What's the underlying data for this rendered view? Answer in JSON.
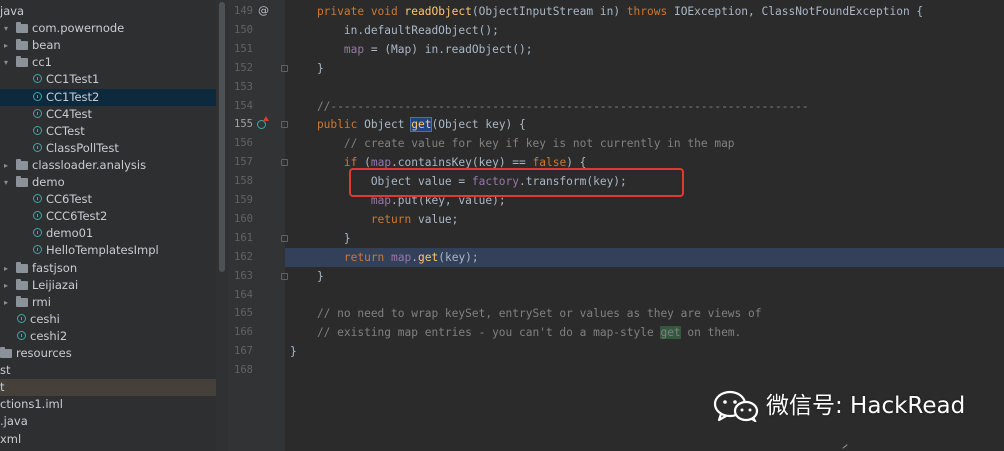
{
  "project_tree": {
    "items": [
      {
        "label": "java",
        "type": "text",
        "indent": 0
      },
      {
        "label": "com.powernode",
        "type": "package",
        "indent": 1,
        "arrow": "open"
      },
      {
        "label": "bean",
        "type": "package",
        "indent": 2,
        "arrow": "closed"
      },
      {
        "label": "cc1",
        "type": "package",
        "indent": 2,
        "arrow": "open"
      },
      {
        "label": "CC1Test1",
        "type": "class",
        "indent": 3
      },
      {
        "label": "CC1Test2",
        "type": "class",
        "indent": 3,
        "state": "selected"
      },
      {
        "label": "CC4Test",
        "type": "class",
        "indent": 3
      },
      {
        "label": "CCTest",
        "type": "class",
        "indent": 3
      },
      {
        "label": "ClassPollTest",
        "type": "class",
        "indent": 3
      },
      {
        "label": "classloader.analysis",
        "type": "package",
        "indent": 2,
        "arrow": "closed"
      },
      {
        "label": "demo",
        "type": "package",
        "indent": 2,
        "arrow": "open"
      },
      {
        "label": "CC6Test",
        "type": "class",
        "indent": 3
      },
      {
        "label": "CCC6Test2",
        "type": "class",
        "indent": 3
      },
      {
        "label": "demo01",
        "type": "class",
        "indent": 3
      },
      {
        "label": "HelloTemplatesImpl",
        "type": "class",
        "indent": 3
      },
      {
        "label": "fastjson",
        "type": "package",
        "indent": 2,
        "arrow": "closed"
      },
      {
        "label": "Leijiazai",
        "type": "package",
        "indent": 2,
        "arrow": "closed"
      },
      {
        "label": "rmi",
        "type": "package",
        "indent": 2,
        "arrow": "closed"
      },
      {
        "label": "ceshi",
        "type": "class",
        "indent": 2
      },
      {
        "label": "ceshi2",
        "type": "class",
        "indent": 2
      },
      {
        "label": "resources",
        "type": "package",
        "indent": 0
      },
      {
        "label": "st",
        "type": "text",
        "indent": 0
      },
      {
        "label": "t",
        "type": "text",
        "indent": 0,
        "state": "highlighted"
      },
      {
        "label": "ctions1.iml",
        "type": "text",
        "indent": 0
      },
      {
        "label": ".java",
        "type": "text",
        "indent": 0
      },
      {
        "label": "xml",
        "type": "text",
        "indent": 0
      }
    ]
  },
  "editor": {
    "current_line": "155",
    "lines": [
      {
        "num": "149",
        "segments": [
          [
            "kw",
            "    private void "
          ],
          [
            "fn",
            "readObject"
          ],
          [
            "",
            "(ObjectInputStream in) "
          ],
          [
            "kw",
            "throws "
          ],
          [
            "",
            "IOException, ClassNotFoundException {"
          ]
        ]
      },
      {
        "num": "150",
        "segments": [
          [
            "",
            "        in.defaultReadObject();"
          ]
        ]
      },
      {
        "num": "151",
        "segments": [
          [
            "",
            "        "
          ],
          [
            "fld",
            "map"
          ],
          [
            "",
            " = (Map) in.readObject();"
          ]
        ]
      },
      {
        "num": "152",
        "segments": [
          [
            "",
            "    }"
          ]
        ]
      },
      {
        "num": "153",
        "segments": []
      },
      {
        "num": "154",
        "segments": [
          [
            "cm",
            "    //-----------------------------------------------------------------------"
          ]
        ]
      },
      {
        "num": "155",
        "segments": [
          [
            "kw",
            "    public "
          ],
          [
            "",
            "Object "
          ],
          [
            "hlbox",
            "get"
          ],
          [
            "",
            "(Object key) {"
          ]
        ]
      },
      {
        "num": "156",
        "segments": [
          [
            "cm",
            "        // create value for key if key is not currently in the map"
          ]
        ]
      },
      {
        "num": "157",
        "segments": [
          [
            "kw",
            "        if "
          ],
          [
            "",
            "("
          ],
          [
            "fld",
            "map"
          ],
          [
            "",
            ".containsKey(key) == "
          ],
          [
            "kw",
            "false"
          ],
          [
            "",
            ") {"
          ]
        ]
      },
      {
        "num": "158",
        "segments": [
          [
            "",
            "            Object value = "
          ],
          [
            "fld",
            "factory"
          ],
          [
            "",
            ".transform(key);"
          ]
        ]
      },
      {
        "num": "159",
        "segments": [
          [
            "",
            "            "
          ],
          [
            "fld",
            "map"
          ],
          [
            "",
            ".put(key, value);"
          ]
        ]
      },
      {
        "num": "160",
        "segments": [
          [
            "kw",
            "            return "
          ],
          [
            "",
            "value;"
          ]
        ]
      },
      {
        "num": "161",
        "segments": [
          [
            "",
            "        }"
          ]
        ]
      },
      {
        "num": "162",
        "segments": [
          [
            "kw",
            "        return "
          ],
          [
            "fld",
            "map"
          ],
          [
            "",
            "."
          ],
          [
            "fn",
            "get"
          ],
          [
            "",
            "(key);"
          ]
        ]
      },
      {
        "num": "163",
        "segments": [
          [
            "",
            "    }"
          ]
        ]
      },
      {
        "num": "164",
        "segments": []
      },
      {
        "num": "165",
        "segments": [
          [
            "cm",
            "    // no need to wrap keySet, entrySet or values as they are views of"
          ]
        ]
      },
      {
        "num": "166",
        "segments": [
          [
            "cm",
            "    // existing map entries - you can't do a map-style "
          ],
          [
            "grn",
            "get"
          ],
          [
            "cm",
            " on them."
          ]
        ]
      },
      {
        "num": "167",
        "segments": [
          [
            "",
            "}"
          ]
        ]
      },
      {
        "num": "168",
        "segments": []
      }
    ],
    "gutter_marker_149": "@"
  },
  "watermark": {
    "text": "微信号: HackRead",
    "icon": "wechat-icon"
  },
  "colors": {
    "keyword": "#cc7832",
    "field": "#9876aa",
    "method": "#ffc66d",
    "comment": "#808080",
    "annotation_box": "#e0392f"
  }
}
